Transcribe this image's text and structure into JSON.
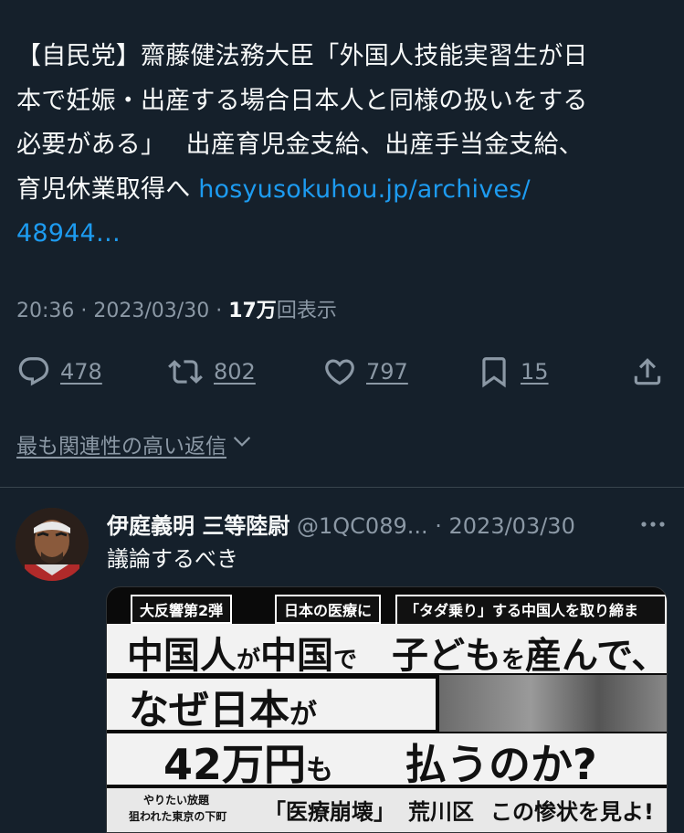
{
  "tweet": {
    "text_line1": "【自民党】齋藤健法務大臣「外国人技能実習生が日",
    "text_line2": "本で妊娠・出産する場合日本人と同様の扱いをする",
    "text_line3": "必要がある」　 出産育児金支給、出産手当金支給、",
    "text_line4_prefix": "育児休業取得へ ",
    "link_part1": "hosyusokuhou.jp/archives/",
    "link_part2": "48944…",
    "time": "20:36",
    "date": "2023/03/30",
    "views_num": "17万",
    "views_label": "回表示",
    "separator": " · "
  },
  "actions": {
    "reply_count": "478",
    "retweet_count": "802",
    "like_count": "797",
    "bookmark_count": "15"
  },
  "relevant_replies_label": "最も関連性の高い返信",
  "reply": {
    "name": "伊庭義明 三等陸尉",
    "handle": "@1QC089...",
    "date": "2023/03/30",
    "text": "議論するべき"
  },
  "media": {
    "tag1": "大反響第2弾",
    "tag2": "日本の医療に",
    "tag3": "「タダ乗り」する中国人を取り締まれ!",
    "headline1a": "中国人",
    "headline1b": "が",
    "headline1c": "中国",
    "headline1d": "で",
    "headline1e": "子ども",
    "headline1f": "を",
    "headline1g": "産んで、",
    "headline2a": "なぜ日本",
    "headline2b": "が",
    "headline3a": "42万円",
    "headline3b": "も",
    "headline3c": "払うのか?",
    "bottom1": "やりたい放題",
    "bottom2": "狙われた東京の下町",
    "bottom3": "「医療崩壊」",
    "bottom4": "荒川区",
    "bottom5": "この惨状を見よ!"
  },
  "colors": {
    "background": "#15202b",
    "text": "#f7f9f9",
    "secondary": "#8b98a5",
    "link": "#1d9bf0"
  }
}
